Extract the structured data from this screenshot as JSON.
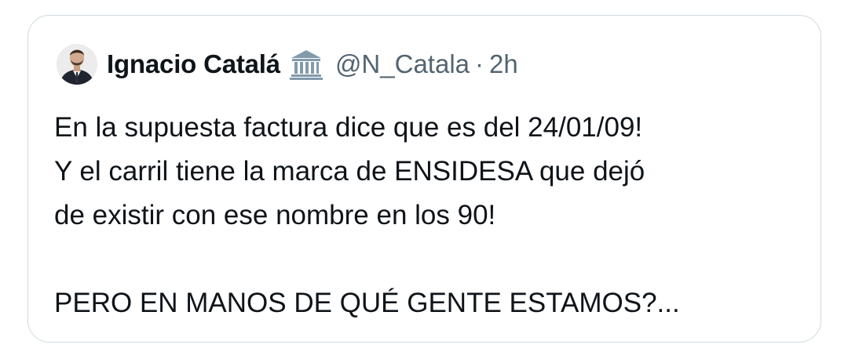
{
  "tweet": {
    "author_name": "Ignacio Catalá",
    "author_handle": "@N_Catala",
    "separator": "·",
    "timestamp": "2h",
    "badge_icon": "government-building-icon",
    "avatar_icon": "profile-photo-man-in-suit",
    "text_lines": [
      "En la supuesta factura dice que es del 24/01/09!",
      "Y el carril tiene la marca de ENSIDESA que dejó",
      "de existir con ese nombre en los 90!",
      "",
      "PERO EN MANOS DE QUÉ GENTE ESTAMOS?..."
    ]
  },
  "colors": {
    "text_primary": "#0f1419",
    "text_secondary": "#536471",
    "border": "#cfd9de",
    "badge_gray": "#829aab"
  }
}
